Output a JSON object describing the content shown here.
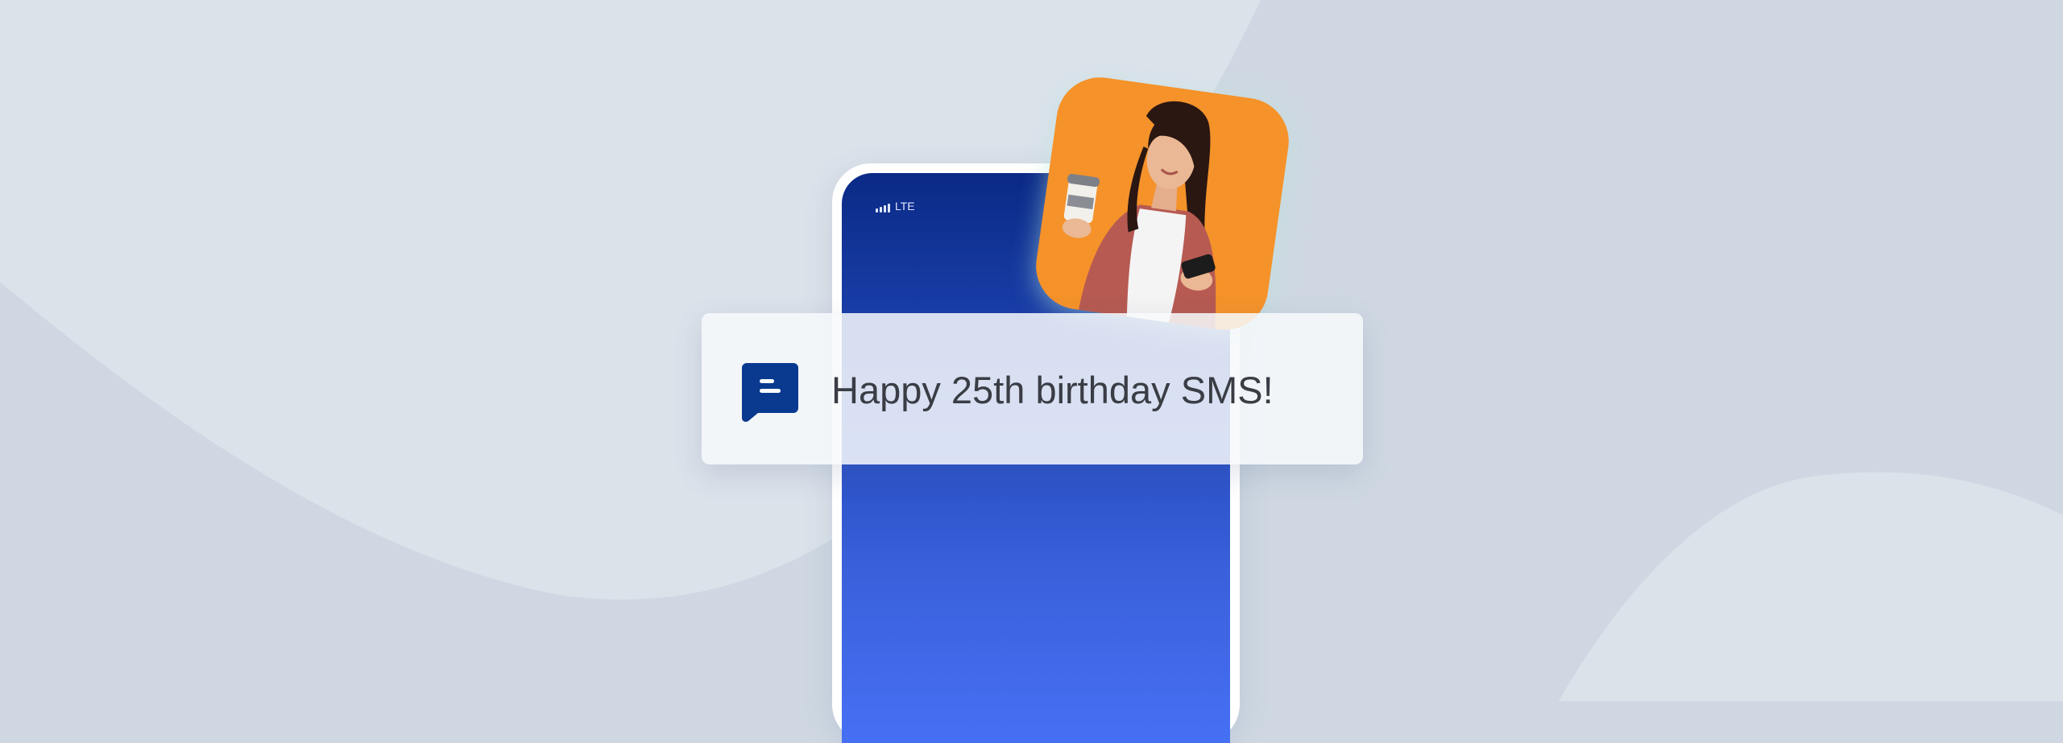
{
  "status_bar": {
    "network": "LTE"
  },
  "notification": {
    "text": "Happy 25th birthday SMS!",
    "icon": "message-icon"
  },
  "photo": {
    "subject": "woman-with-phone-and-coffee"
  },
  "colors": {
    "background": "#cfd8e2",
    "background_light": "#dbe2ea",
    "phone_screen_top": "#0b2a86",
    "phone_screen_bottom": "#4670f4",
    "photo_bg": "#f5922a",
    "icon_blue": "#0a3a8f",
    "text": "#3a3d44"
  }
}
